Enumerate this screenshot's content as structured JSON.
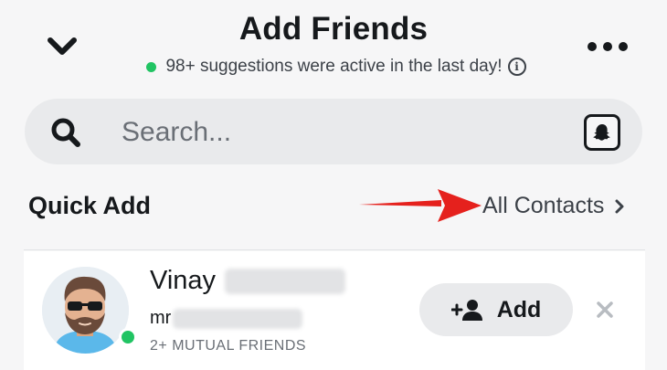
{
  "header": {
    "title": "Add Friends",
    "subtitle": "98+ suggestions were active in the last day!"
  },
  "search": {
    "placeholder": "Search..."
  },
  "quick_add": {
    "section_title": "Quick Add",
    "all_contacts_label": "All Contacts"
  },
  "suggestion": {
    "name": "Vinay",
    "username_prefix": "mr",
    "mutual": "2+ MUTUAL FRIENDS",
    "add_label": "Add",
    "online": true
  },
  "colors": {
    "online": "#21c463",
    "annotation_arrow": "#e5211d",
    "background": "#f6f6f7",
    "card": "#ffffff",
    "pill": "#e9eaec"
  }
}
